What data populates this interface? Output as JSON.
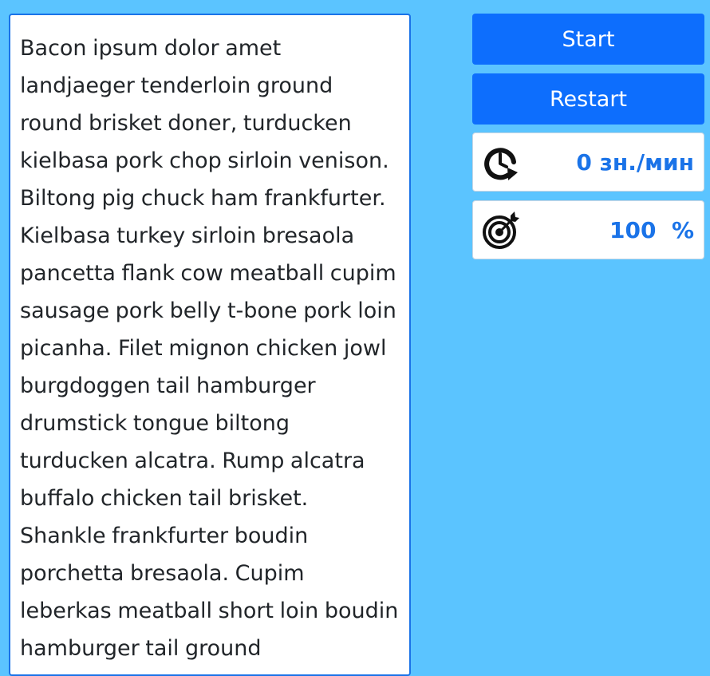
{
  "text_panel": {
    "paragraph": "Bacon ipsum dolor amet landjaeger tenderloin ground round brisket doner, turducken kielbasa pork chop sirloin venison. Biltong pig chuck ham frankfurter. Kielbasa turkey sirloin bresaola pancetta flank cow meatball cupim sausage pork belly t-bone pork loin picanha. Filet mignon chicken jowl burgdoggen tail hamburger drumstick tongue biltong turducken alcatra. Rump alcatra buffalo chicken tail brisket. Shankle frankfurter boudin porchetta bresaola. Cupim leberkas meatball short loin boudin hamburger tail ground"
  },
  "controls": {
    "start_label": "Start",
    "restart_label": "Restart"
  },
  "stats": {
    "speed": {
      "value": "0",
      "unit": "зн./мин",
      "icon": "stopwatch-icon"
    },
    "accuracy": {
      "value": "100",
      "unit": "%",
      "icon": "target-icon"
    }
  },
  "colors": {
    "background": "#5bc4ff",
    "button": "#0d6efd",
    "accent_text": "#1a73e8",
    "panel_border": "#1a73e8"
  }
}
